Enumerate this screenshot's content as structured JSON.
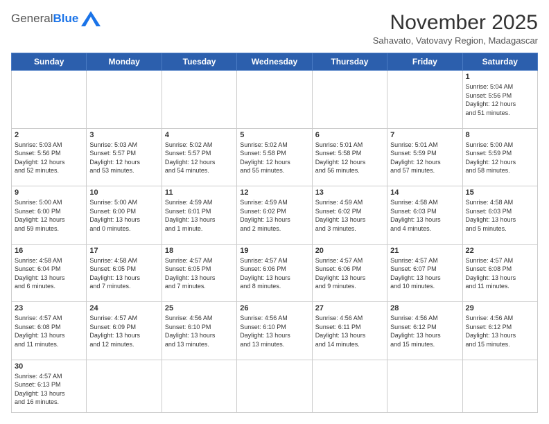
{
  "header": {
    "logo_general": "General",
    "logo_blue": "Blue",
    "month_title": "November 2025",
    "subtitle": "Sahavato, Vatovavy Region, Madagascar"
  },
  "days_of_week": [
    "Sunday",
    "Monday",
    "Tuesday",
    "Wednesday",
    "Thursday",
    "Friday",
    "Saturday"
  ],
  "weeks": [
    [
      {
        "day": "",
        "info": ""
      },
      {
        "day": "",
        "info": ""
      },
      {
        "day": "",
        "info": ""
      },
      {
        "day": "",
        "info": ""
      },
      {
        "day": "",
        "info": ""
      },
      {
        "day": "",
        "info": ""
      },
      {
        "day": "1",
        "info": "Sunrise: 5:04 AM\nSunset: 5:56 PM\nDaylight: 12 hours\nand 51 minutes."
      }
    ],
    [
      {
        "day": "2",
        "info": "Sunrise: 5:03 AM\nSunset: 5:56 PM\nDaylight: 12 hours\nand 52 minutes."
      },
      {
        "day": "3",
        "info": "Sunrise: 5:03 AM\nSunset: 5:57 PM\nDaylight: 12 hours\nand 53 minutes."
      },
      {
        "day": "4",
        "info": "Sunrise: 5:02 AM\nSunset: 5:57 PM\nDaylight: 12 hours\nand 54 minutes."
      },
      {
        "day": "5",
        "info": "Sunrise: 5:02 AM\nSunset: 5:58 PM\nDaylight: 12 hours\nand 55 minutes."
      },
      {
        "day": "6",
        "info": "Sunrise: 5:01 AM\nSunset: 5:58 PM\nDaylight: 12 hours\nand 56 minutes."
      },
      {
        "day": "7",
        "info": "Sunrise: 5:01 AM\nSunset: 5:59 PM\nDaylight: 12 hours\nand 57 minutes."
      },
      {
        "day": "8",
        "info": "Sunrise: 5:00 AM\nSunset: 5:59 PM\nDaylight: 12 hours\nand 58 minutes."
      }
    ],
    [
      {
        "day": "9",
        "info": "Sunrise: 5:00 AM\nSunset: 6:00 PM\nDaylight: 12 hours\nand 59 minutes."
      },
      {
        "day": "10",
        "info": "Sunrise: 5:00 AM\nSunset: 6:00 PM\nDaylight: 13 hours\nand 0 minutes."
      },
      {
        "day": "11",
        "info": "Sunrise: 4:59 AM\nSunset: 6:01 PM\nDaylight: 13 hours\nand 1 minute."
      },
      {
        "day": "12",
        "info": "Sunrise: 4:59 AM\nSunset: 6:02 PM\nDaylight: 13 hours\nand 2 minutes."
      },
      {
        "day": "13",
        "info": "Sunrise: 4:59 AM\nSunset: 6:02 PM\nDaylight: 13 hours\nand 3 minutes."
      },
      {
        "day": "14",
        "info": "Sunrise: 4:58 AM\nSunset: 6:03 PM\nDaylight: 13 hours\nand 4 minutes."
      },
      {
        "day": "15",
        "info": "Sunrise: 4:58 AM\nSunset: 6:03 PM\nDaylight: 13 hours\nand 5 minutes."
      }
    ],
    [
      {
        "day": "16",
        "info": "Sunrise: 4:58 AM\nSunset: 6:04 PM\nDaylight: 13 hours\nand 6 minutes."
      },
      {
        "day": "17",
        "info": "Sunrise: 4:58 AM\nSunset: 6:05 PM\nDaylight: 13 hours\nand 7 minutes."
      },
      {
        "day": "18",
        "info": "Sunrise: 4:57 AM\nSunset: 6:05 PM\nDaylight: 13 hours\nand 7 minutes."
      },
      {
        "day": "19",
        "info": "Sunrise: 4:57 AM\nSunset: 6:06 PM\nDaylight: 13 hours\nand 8 minutes."
      },
      {
        "day": "20",
        "info": "Sunrise: 4:57 AM\nSunset: 6:06 PM\nDaylight: 13 hours\nand 9 minutes."
      },
      {
        "day": "21",
        "info": "Sunrise: 4:57 AM\nSunset: 6:07 PM\nDaylight: 13 hours\nand 10 minutes."
      },
      {
        "day": "22",
        "info": "Sunrise: 4:57 AM\nSunset: 6:08 PM\nDaylight: 13 hours\nand 11 minutes."
      }
    ],
    [
      {
        "day": "23",
        "info": "Sunrise: 4:57 AM\nSunset: 6:08 PM\nDaylight: 13 hours\nand 11 minutes."
      },
      {
        "day": "24",
        "info": "Sunrise: 4:57 AM\nSunset: 6:09 PM\nDaylight: 13 hours\nand 12 minutes."
      },
      {
        "day": "25",
        "info": "Sunrise: 4:56 AM\nSunset: 6:10 PM\nDaylight: 13 hours\nand 13 minutes."
      },
      {
        "day": "26",
        "info": "Sunrise: 4:56 AM\nSunset: 6:10 PM\nDaylight: 13 hours\nand 13 minutes."
      },
      {
        "day": "27",
        "info": "Sunrise: 4:56 AM\nSunset: 6:11 PM\nDaylight: 13 hours\nand 14 minutes."
      },
      {
        "day": "28",
        "info": "Sunrise: 4:56 AM\nSunset: 6:12 PM\nDaylight: 13 hours\nand 15 minutes."
      },
      {
        "day": "29",
        "info": "Sunrise: 4:56 AM\nSunset: 6:12 PM\nDaylight: 13 hours\nand 15 minutes."
      }
    ],
    [
      {
        "day": "30",
        "info": "Sunrise: 4:57 AM\nSunset: 6:13 PM\nDaylight: 13 hours\nand 16 minutes."
      },
      {
        "day": "",
        "info": ""
      },
      {
        "day": "",
        "info": ""
      },
      {
        "day": "",
        "info": ""
      },
      {
        "day": "",
        "info": ""
      },
      {
        "day": "",
        "info": ""
      },
      {
        "day": "",
        "info": ""
      }
    ]
  ]
}
